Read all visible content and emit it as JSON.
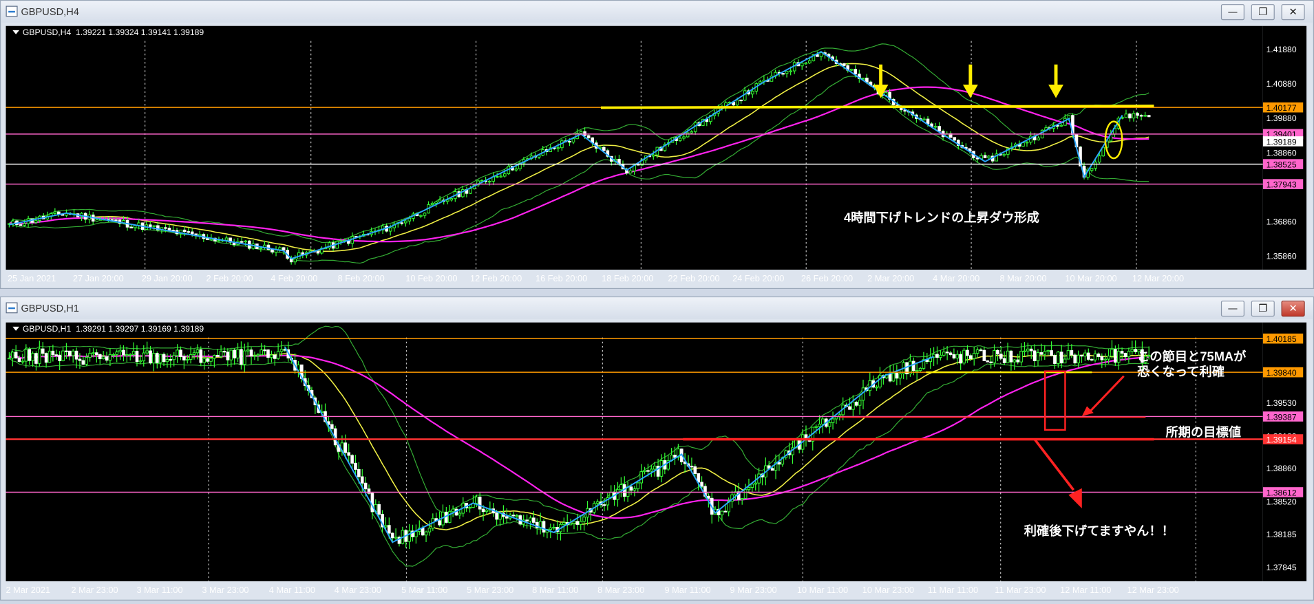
{
  "windows": [
    {
      "title": "GBPUSD,H4",
      "header": "GBPUSD,H4  1.39221 1.39324 1.39141 1.39189",
      "prices": [
        "1.41880",
        "1.40880",
        "1.39880",
        "1.39189",
        "1.38860",
        "1.36860",
        "1.35860"
      ],
      "tags": [
        {
          "label": "1.40177",
          "bg": "#ff9900",
          "fg": "#000000"
        },
        {
          "label": "1.39401",
          "bg": "#ff66cc",
          "fg": "#000000"
        },
        {
          "label": "1.39189",
          "bg": "#ffffff",
          "fg": "#000000"
        },
        {
          "label": "1.38525",
          "bg": "#ff66cc",
          "fg": "#000000"
        },
        {
          "label": "1.37943",
          "bg": "#ff66cc",
          "fg": "#000000"
        }
      ],
      "times": [
        "25 Jan 2021",
        "27 Jan 20:00",
        "29 Jan 20:00",
        "2 Feb 20:00",
        "4 Feb 20:00",
        "8 Feb 20:00",
        "10 Feb 20:00",
        "12 Feb 20:00",
        "16 Feb 20:00",
        "18 Feb 20:00",
        "22 Feb 20:00",
        "24 Feb 20:00",
        "26 Feb 20:00",
        "2 Mar 20:00",
        "4 Mar 20:00",
        "8 Mar 20:00",
        "10 Mar 20:00",
        "12 Mar 20:00"
      ],
      "annotations": [
        "4時間下げトレンドの上昇ダウ形成"
      ]
    },
    {
      "title": "GBPUSD,H1",
      "header": "GBPUSD,H1  1.39291 1.39297 1.39169 1.39189",
      "prices": [
        "1.39530",
        "1.38860",
        "1.38520",
        "1.38185",
        "1.37845",
        "1.39189"
      ],
      "tags": [
        {
          "label": "1.40185",
          "bg": "#ff9900",
          "fg": "#000000"
        },
        {
          "label": "1.39840",
          "bg": "#ff9900",
          "fg": "#000000"
        },
        {
          "label": "1.39387",
          "bg": "#ff66cc",
          "fg": "#000000"
        },
        {
          "label": "1.39154",
          "bg": "#ff3333",
          "fg": "#ffffff"
        },
        {
          "label": "1.38612",
          "bg": "#ff66cc",
          "fg": "#000000"
        }
      ],
      "times": [
        "2 Mar 2021",
        "2 Mar 23:00",
        "3 Mar 11:00",
        "3 Mar 23:00",
        "4 Mar 11:00",
        "4 Mar 23:00",
        "5 Mar 11:00",
        "5 Mar 23:00",
        "8 Mar 11:00",
        "8 Mar 23:00",
        "9 Mar 11:00",
        "9 Mar 23:00",
        "10 Mar 11:00",
        "10 Mar 23:00",
        "11 Mar 11:00",
        "11 Mar 23:00",
        "12 Mar 11:00",
        "12 Mar 23:00"
      ],
      "annotations": [
        "この節目と75MAが",
        "恐くなって利確",
        "所期の目標値",
        "利確後下げてますやん！！"
      ]
    }
  ],
  "chart_data": [
    {
      "type": "candlestick",
      "title": "GBPUSD,H4",
      "ohlc_last": {
        "open": 1.39221,
        "high": 1.39324,
        "low": 1.39141,
        "close": 1.39189
      },
      "ylim": [
        1.3545,
        1.4255
      ],
      "x_ticks": [
        "25 Jan 2021",
        "27 Jan 20:00",
        "29 Jan 20:00",
        "2 Feb 20:00",
        "4 Feb 20:00",
        "8 Feb 20:00",
        "10 Feb 20:00",
        "12 Feb 20:00",
        "16 Feb 20:00",
        "18 Feb 20:00",
        "22 Feb 20:00",
        "24 Feb 20:00",
        "26 Feb 20:00",
        "2 Mar 20:00",
        "4 Mar 20:00",
        "8 Mar 20:00",
        "10 Mar 20:00",
        "12 Mar 20:00"
      ],
      "swing_path": [
        1.3676,
        1.371,
        1.36,
        1.3577,
        1.367,
        1.394,
        1.3835,
        1.4092,
        1.418,
        1.396,
        1.386,
        1.3985,
        1.3815,
        1.3995
      ],
      "horizontal_levels": [
        1.40177,
        1.39401,
        1.38525,
        1.37943
      ],
      "ma_slow": [
        1.359,
        1.3605,
        1.3625,
        1.366,
        1.37,
        1.375,
        1.38,
        1.385,
        1.388,
        1.3905,
        1.3925,
        1.394
      ],
      "annotations": [
        "4時間下げトレンドの上昇ダウ形成"
      ]
    },
    {
      "type": "candlestick",
      "title": "GBPUSD,H1",
      "ohlc_last": {
        "open": 1.39291,
        "high": 1.39297,
        "low": 1.39169,
        "close": 1.39189
      },
      "ylim": [
        1.377,
        1.4035
      ],
      "x_ticks": [
        "2 Mar 2021",
        "2 Mar 23:00",
        "3 Mar 11:00",
        "3 Mar 23:00",
        "4 Mar 11:00",
        "4 Mar 23:00",
        "5 Mar 11:00",
        "5 Mar 23:00",
        "8 Mar 11:00",
        "8 Mar 23:00",
        "9 Mar 11:00",
        "9 Mar 23:00",
        "10 Mar 11:00",
        "10 Mar 23:00",
        "11 Mar 11:00",
        "11 Mar 23:00",
        "12 Mar 11:00",
        "12 Mar 23:00"
      ],
      "swing_path": [
        1.401,
        1.381,
        1.385,
        1.382,
        1.39,
        1.384,
        1.398,
        1.4
      ],
      "horizontal_levels": [
        1.40185,
        1.3984,
        1.39387,
        1.39154,
        1.38612
      ],
      "annotations": [
        "この節目と75MAが",
        "恐くなって利確",
        "所期の目標値",
        "利確後下げてますやん！！"
      ]
    }
  ]
}
